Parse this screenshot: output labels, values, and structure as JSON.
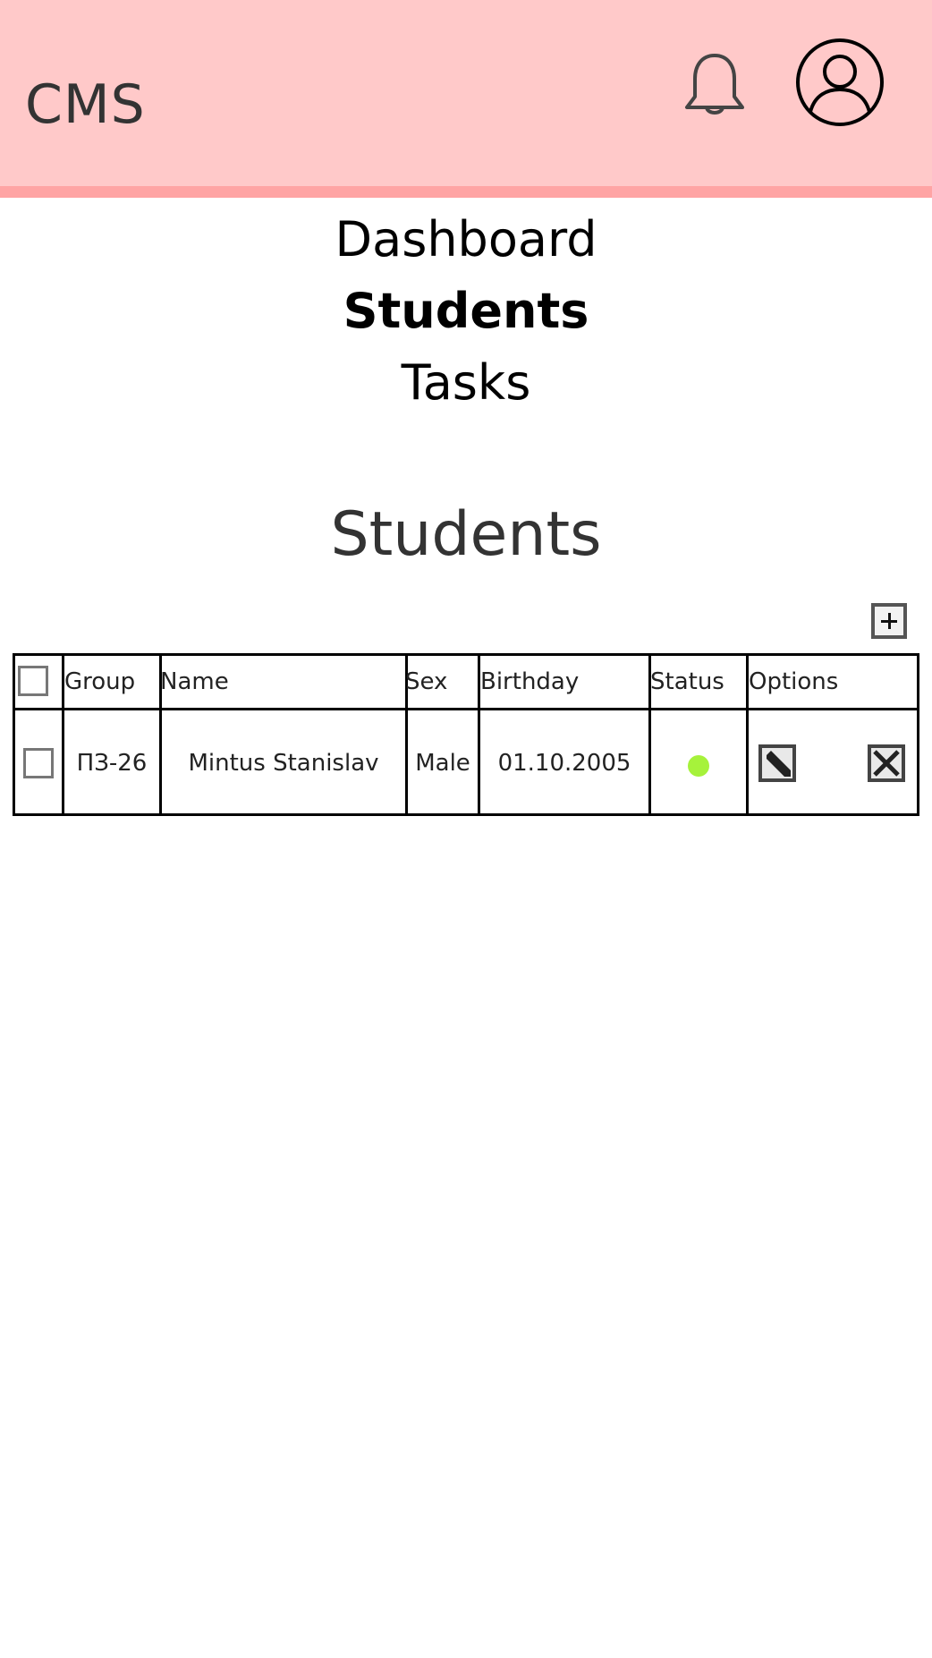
{
  "header": {
    "brand": "CMS",
    "background_color": "#ffc9c9",
    "accent_line_color": "#ffa4a4",
    "notifications_icon": "bell-icon",
    "profile_icon": "user-avatar-icon"
  },
  "nav": {
    "items": [
      {
        "label": "Dashboard",
        "active": false
      },
      {
        "label": "Students",
        "active": true
      },
      {
        "label": "Tasks",
        "active": false
      }
    ]
  },
  "main": {
    "title": "Students",
    "add_icon": "plus-square-icon"
  },
  "table": {
    "columns": [
      "Group",
      "Name",
      "Sex",
      "Birthday",
      "Status",
      "Options"
    ],
    "rows": [
      {
        "checked": false,
        "group": "ПЗ-26",
        "name": "Mintus Stanislav",
        "sex": "Male",
        "birthday": "01.10.2005",
        "status_color": "#a6f23b",
        "edit_icon": "edit-icon",
        "delete_icon": "delete-x-icon"
      }
    ]
  }
}
